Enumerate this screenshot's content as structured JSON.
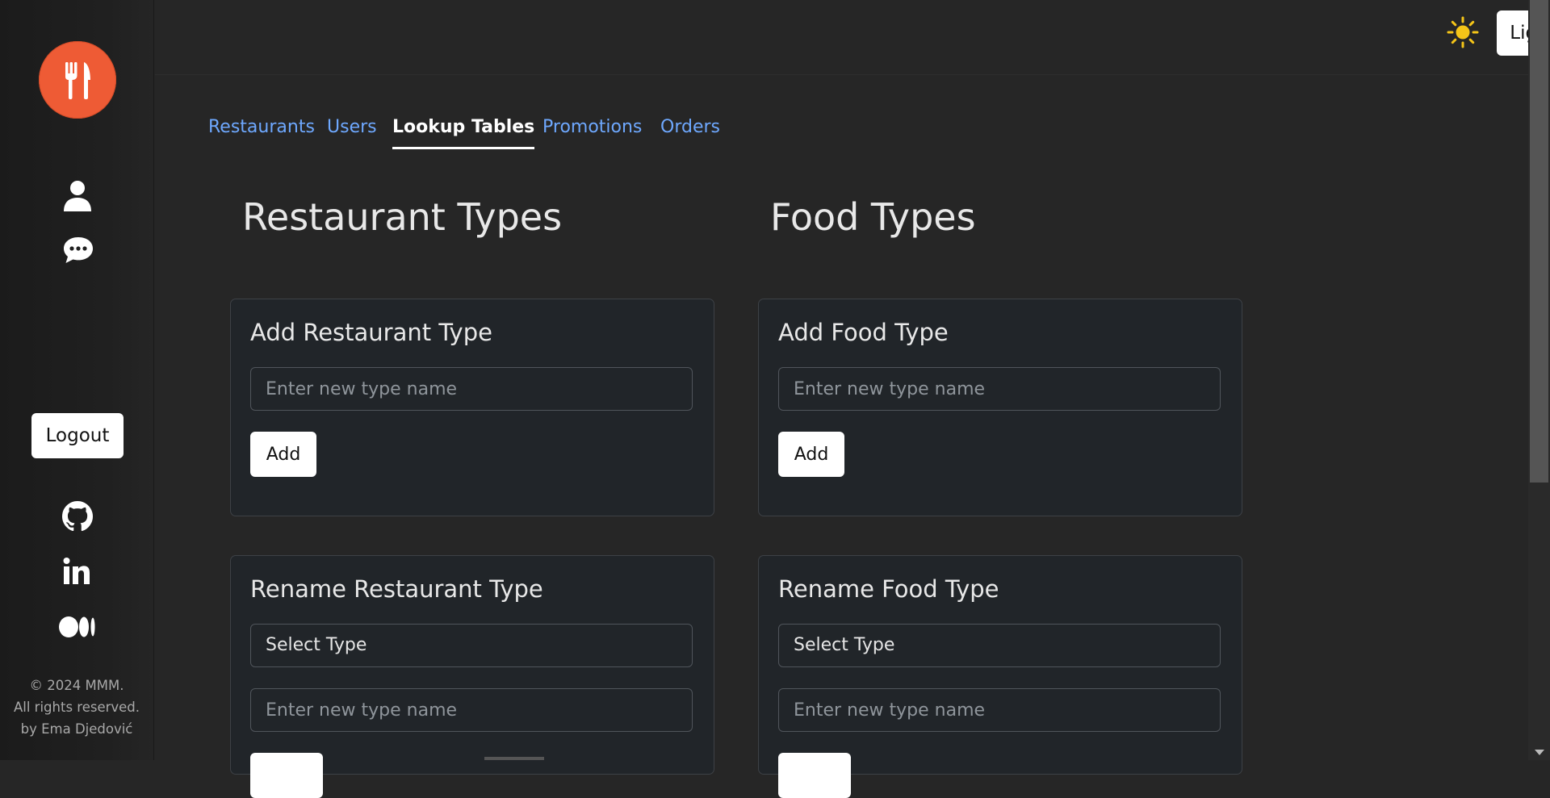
{
  "header": {
    "mode_button_label": "Light Mode",
    "theme_icon": "sun-icon"
  },
  "sidebar": {
    "logo_icon": "fork-knife-icon",
    "nav_icons": [
      "user-icon",
      "chat-icon"
    ],
    "logout_label": "Logout",
    "social_icons": [
      "github-icon",
      "linkedin-icon",
      "medium-icon"
    ],
    "copyright_lines": [
      "© 2024 MMM.",
      "All rights reserved.",
      "by Ema Djedović"
    ]
  },
  "tabs": [
    {
      "label": "Restaurants",
      "active": false
    },
    {
      "label": "Users",
      "active": false
    },
    {
      "label": "Lookup Tables",
      "active": true
    },
    {
      "label": "Promotions",
      "active": false
    },
    {
      "label": "Orders",
      "active": false
    }
  ],
  "restaurant_types": {
    "title": "Restaurant Types",
    "add_card": {
      "title": "Add Restaurant Type",
      "input_placeholder": "Enter new type name",
      "button_label": "Add"
    },
    "rename_card": {
      "title": "Rename Restaurant Type",
      "select_value": "Select Type",
      "input_placeholder": "Enter new type name"
    }
  },
  "food_types": {
    "title": "Food Types",
    "add_card": {
      "title": "Add Food Type",
      "input_placeholder": "Enter new type name",
      "button_label": "Add"
    },
    "rename_card": {
      "title": "Rename Food Type",
      "select_value": "Select Type",
      "input_placeholder": "Enter new type name"
    }
  },
  "colors": {
    "background": "#262626",
    "sidebar": "#1e1e1e",
    "accent": "#ee5b35",
    "link": "#6ea8fe",
    "card": "#212529",
    "sun": "#f5c518"
  }
}
